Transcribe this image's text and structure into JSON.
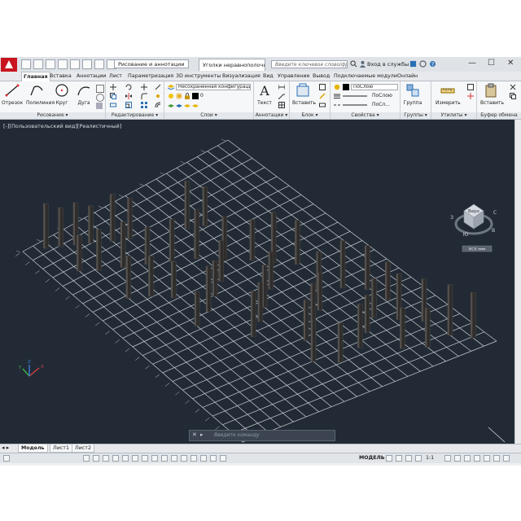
{
  "titlebar": {
    "workspace": "Рисование и аннотации",
    "document_tab": "Уголки неравнополочные...",
    "search_placeholder": "Введите ключевое слово/фразу",
    "sign_in": "Вход в службы",
    "minimize": "—",
    "maximize": "☐",
    "close": "✕"
  },
  "ribbon_tabs": [
    {
      "label": "Главная",
      "active": true
    },
    {
      "label": "Вставка"
    },
    {
      "label": "Аннотации"
    },
    {
      "label": "Лист"
    },
    {
      "label": "Параметризация"
    },
    {
      "label": "3D инструменты"
    },
    {
      "label": "Визуализация"
    },
    {
      "label": "Вид"
    },
    {
      "label": "Управление"
    },
    {
      "label": "Вывод"
    },
    {
      "label": "Подключаемые модули"
    },
    {
      "label": "Онлайн"
    }
  ],
  "ribbon": {
    "draw": {
      "title": "Рисование ▾",
      "line": "Отрезок",
      "polyline": "Полилиния",
      "circle": "Круг",
      "arc": "Дуга"
    },
    "modify": {
      "title": "Редактирование ▾"
    },
    "layers": {
      "title": "Слои ▾",
      "layer_state": "Несохраненная конфигурация сло",
      "current_layer": "0"
    },
    "annotation": {
      "title": "Аннотации ▾",
      "text": "Текст"
    },
    "block": {
      "title": "Блок ▾",
      "insert": "Вставить"
    },
    "properties": {
      "title": "Свойства ▾",
      "color": "ПоСлою",
      "linetype": "ПоСлою",
      "lineweight": "ПоСл..."
    },
    "groups": {
      "title": "Группы ▾",
      "group": "Группа"
    },
    "utilities": {
      "title": "Утилиты ▾",
      "measure": "Измерить"
    },
    "clipboard": {
      "title": "Буфер обмена",
      "paste": "Вставить"
    }
  },
  "viewport": {
    "label": "[-][Пользовательский вид][Реалистичный]",
    "viewcube_face": "Верх",
    "viewcube_compass": [
      "С",
      "З",
      "Ю",
      "В"
    ],
    "wcs_label": "МСК ▾▾▾▾",
    "axis_x": "X",
    "axis_y": "Y",
    "axis_z": "Z"
  },
  "layout_tabs": [
    "Модель",
    "Лист1",
    "Лист2"
  ],
  "command": {
    "placeholder": "Введите команду"
  },
  "status": {
    "space": "МОДЕЛЬ",
    "scale": "1:1"
  },
  "colors": {
    "viewport_bg": "#222b35",
    "grid": "#c9ced4",
    "object": "#3d3a38",
    "logo": "#c8141e"
  }
}
